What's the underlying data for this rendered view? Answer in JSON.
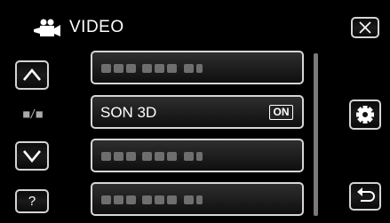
{
  "header": {
    "title": "VIDEO",
    "mode_icon": "video-camera-icon",
    "close_icon": "close-icon"
  },
  "nav": {
    "up_icon": "chevron-up-icon",
    "page_indicator": "■/■",
    "down_icon": "chevron-down-icon",
    "help_label": "?"
  },
  "menu": {
    "items": [
      {
        "label": "",
        "placeholder": true
      },
      {
        "label": "SON 3D",
        "value": "ON",
        "placeholder": false
      },
      {
        "label": "",
        "placeholder": true
      },
      {
        "label": "",
        "placeholder": true
      }
    ]
  },
  "actions": {
    "settings_icon": "gear-icon",
    "back_icon": "return-arrow-icon"
  },
  "colors": {
    "background": "#000000",
    "button_border": "#d4d4d4",
    "placeholder_text": "#6e6e6e",
    "scrollbar": "#7a7a7a"
  }
}
